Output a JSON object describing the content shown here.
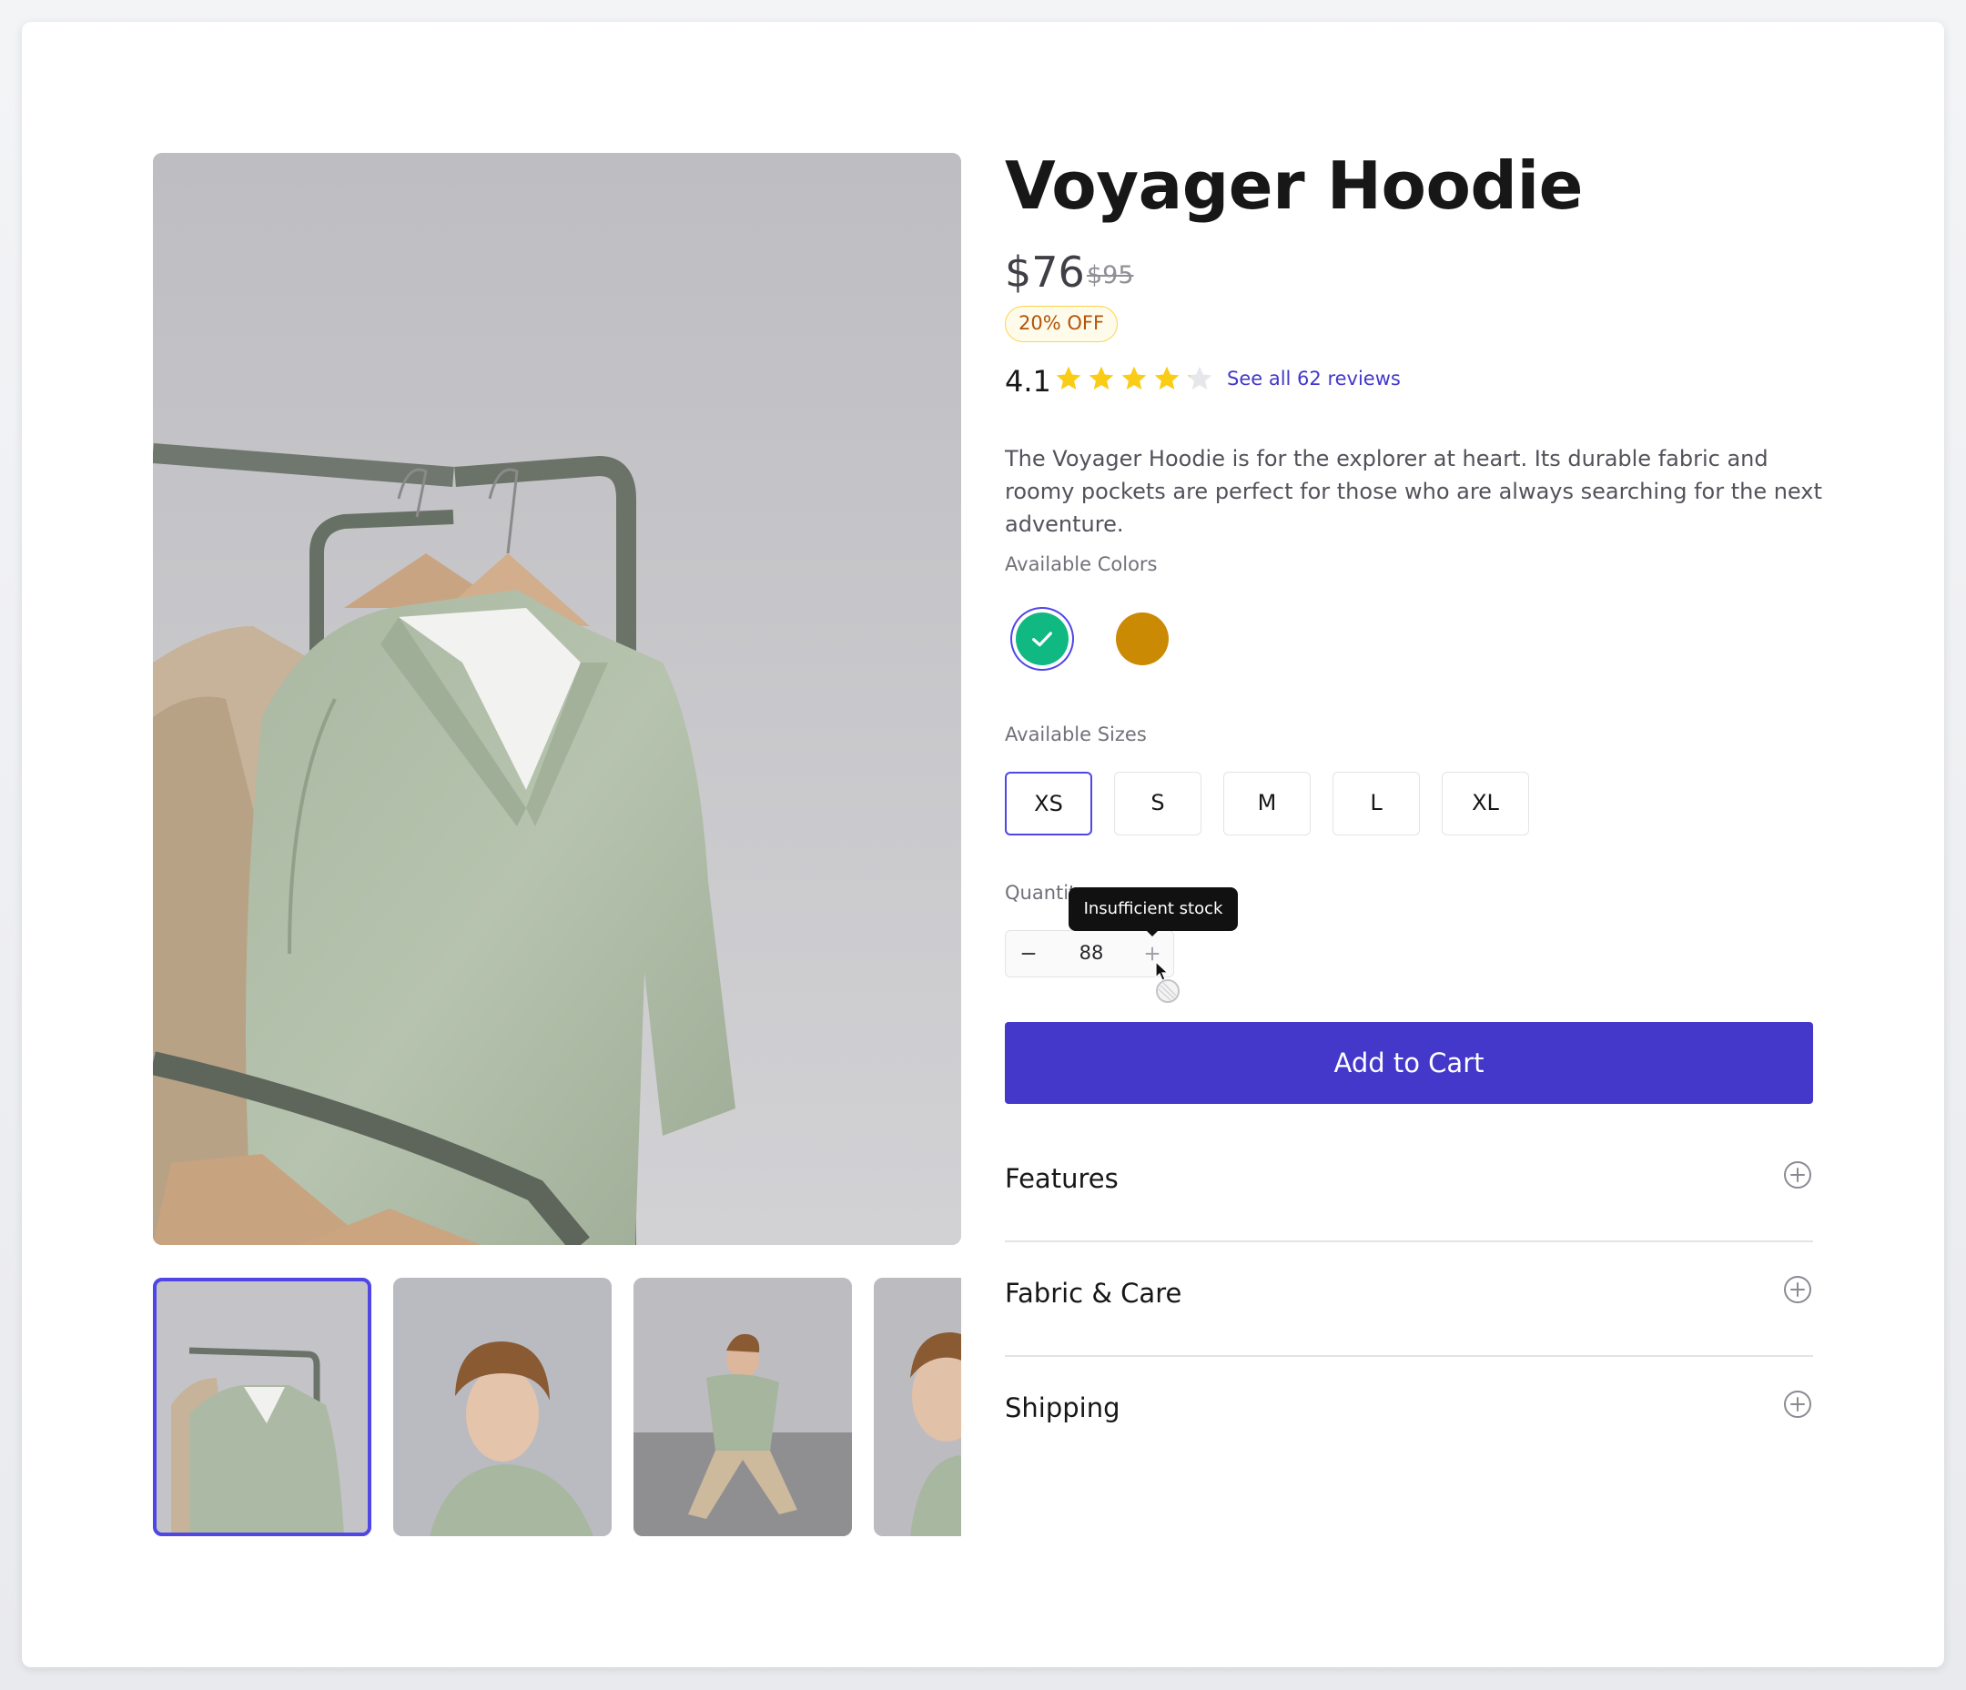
{
  "product": {
    "title": "Voyager Hoodie",
    "price": "$76",
    "original_price": "$95",
    "discount_badge": "20% OFF",
    "rating": "4.1",
    "stars_filled": 4.1,
    "reviews_link": "See all 62 reviews",
    "description": "The Voyager Hoodie is for the explorer at heart. Its durable fabric and roomy pockets are perfect for those who are always searching for the next adventure."
  },
  "colors": {
    "label": "Available Colors",
    "options": [
      {
        "name": "green",
        "hex": "#10b981",
        "selected": true
      },
      {
        "name": "amber",
        "hex": "#ca8a04",
        "selected": false
      }
    ]
  },
  "sizes": {
    "label": "Available Sizes",
    "options": [
      "XS",
      "S",
      "M",
      "L",
      "XL"
    ],
    "selected": "XS"
  },
  "quantity": {
    "label": "Quantity",
    "value": "88",
    "tooltip": "Insufficient stock"
  },
  "actions": {
    "add_to_cart": "Add to Cart"
  },
  "accordion": [
    {
      "title": "Features"
    },
    {
      "title": "Fabric & Care"
    },
    {
      "title": "Shipping"
    }
  ],
  "gallery": {
    "thumbnail_count": 4,
    "selected_index": 0
  },
  "theme": {
    "accent": "#4338ca",
    "star": "#facc15"
  }
}
